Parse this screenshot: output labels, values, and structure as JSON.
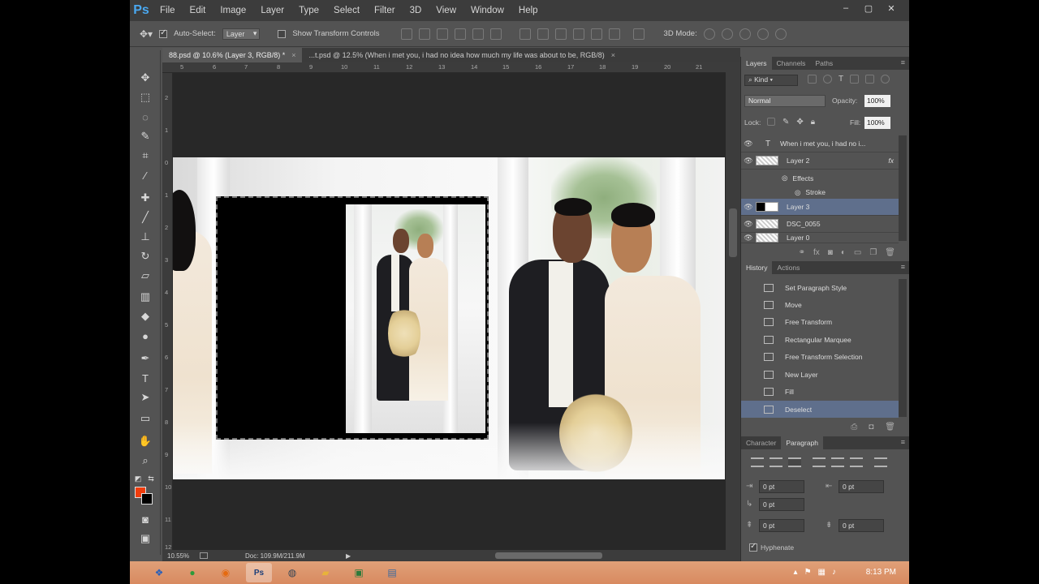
{
  "app": {
    "logo": "Ps",
    "menu": [
      "File",
      "Edit",
      "Image",
      "Layer",
      "Type",
      "Select",
      "Filter",
      "3D",
      "View",
      "Window",
      "Help"
    ],
    "window_buttons": [
      "–",
      "▢",
      "✕"
    ]
  },
  "options": {
    "auto_select_label": "Auto-Select:",
    "auto_select_target": "Layer",
    "show_transform_label": "Show Transform Controls",
    "mode_3d_label": "3D Mode:"
  },
  "tabs": [
    {
      "label": "88.psd @ 10.6% (Layer 3, RGB/8) *",
      "close": "×"
    },
    {
      "label": "...t.psd @ 12.5% (When i met you, i had no idea how much my life  was about to be, RGB/8)",
      "close": "×"
    }
  ],
  "rulers": {
    "top": [
      "5",
      "6",
      "7",
      "8",
      "9",
      "10",
      "11",
      "12",
      "13",
      "14",
      "15",
      "16",
      "17",
      "18",
      "19",
      "20",
      "21"
    ],
    "left": [
      "2",
      "1",
      "0",
      "1",
      "2",
      "3",
      "4",
      "5",
      "6",
      "7",
      "8",
      "9",
      "10",
      "11",
      "12"
    ]
  },
  "status": {
    "zoom": "10.55%",
    "doc": "Doc: 109.9M/211.9M",
    "arrow": "▶"
  },
  "layers_panel": {
    "tabs": [
      "Layers",
      "Channels",
      "Paths"
    ],
    "kind": "Kind",
    "blend_mode": "Normal",
    "opacity_label": "Opacity:",
    "opacity": "100%",
    "lock_label": "Lock:",
    "fill_label": "Fill:",
    "fill": "100%",
    "rows": [
      {
        "name": "When i met you, i had no i...",
        "type": "T"
      },
      {
        "name": "Layer 2",
        "fx": "fx"
      },
      {
        "name": "Effects"
      },
      {
        "name": "Stroke"
      },
      {
        "name": "Layer 3"
      },
      {
        "name": "DSC_0055"
      },
      {
        "name": "Layer 0"
      }
    ]
  },
  "history_panel": {
    "tabs": [
      "History",
      "Actions"
    ],
    "rows": [
      "Set Paragraph Style",
      "Move",
      "Free Transform",
      "Rectangular Marquee",
      "Free Transform Selection",
      "New Layer",
      "Fill",
      "Deselect"
    ]
  },
  "paragraph_panel": {
    "tabs": [
      "Character",
      "Paragraph"
    ],
    "fields": [
      "0 pt",
      "0 pt",
      "0 pt",
      "0 pt",
      "0 pt"
    ],
    "hyphenate_label": "Hyphenate"
  },
  "taskbar": {
    "clock": "8:13 PM"
  },
  "colors": {
    "foreground": "#f03c0c",
    "background": "#000000",
    "accent": "#4aa8f0"
  }
}
